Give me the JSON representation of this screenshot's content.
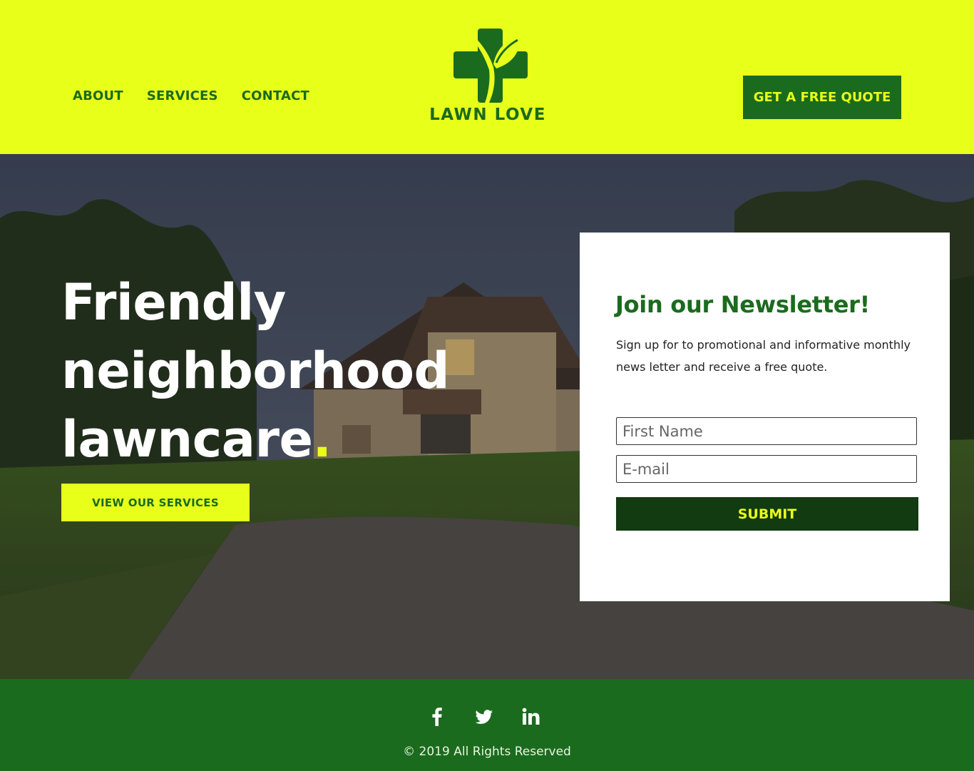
{
  "header": {
    "nav": [
      {
        "label": "ABOUT"
      },
      {
        "label": "SERVICES"
      },
      {
        "label": "CONTACT"
      }
    ],
    "logo_text": "LAWN LOVE",
    "quote_button": "GET A FREE QUOTE"
  },
  "hero": {
    "title_line1": "Friendly",
    "title_line2": "neighborhood",
    "title_line3": "lawncare",
    "title_dot": ".",
    "cta_button": "VIEW OUR SERVICES"
  },
  "newsletter": {
    "title": "Join our Newsletter!",
    "description": "Sign up for to promotional and informative monthly news letter and receive a free quote.",
    "first_name_placeholder": "First Name",
    "email_placeholder": "E-mail",
    "submit_label": "SUBMIT"
  },
  "footer": {
    "social_icons": [
      "facebook-icon",
      "twitter-icon",
      "linkedin-icon"
    ],
    "copyright": "© 2019 All Rights Reserved"
  },
  "colors": {
    "accent_yellow": "#e8ff1a",
    "brand_green": "#1b6b1e",
    "dark_green": "#123b12"
  }
}
